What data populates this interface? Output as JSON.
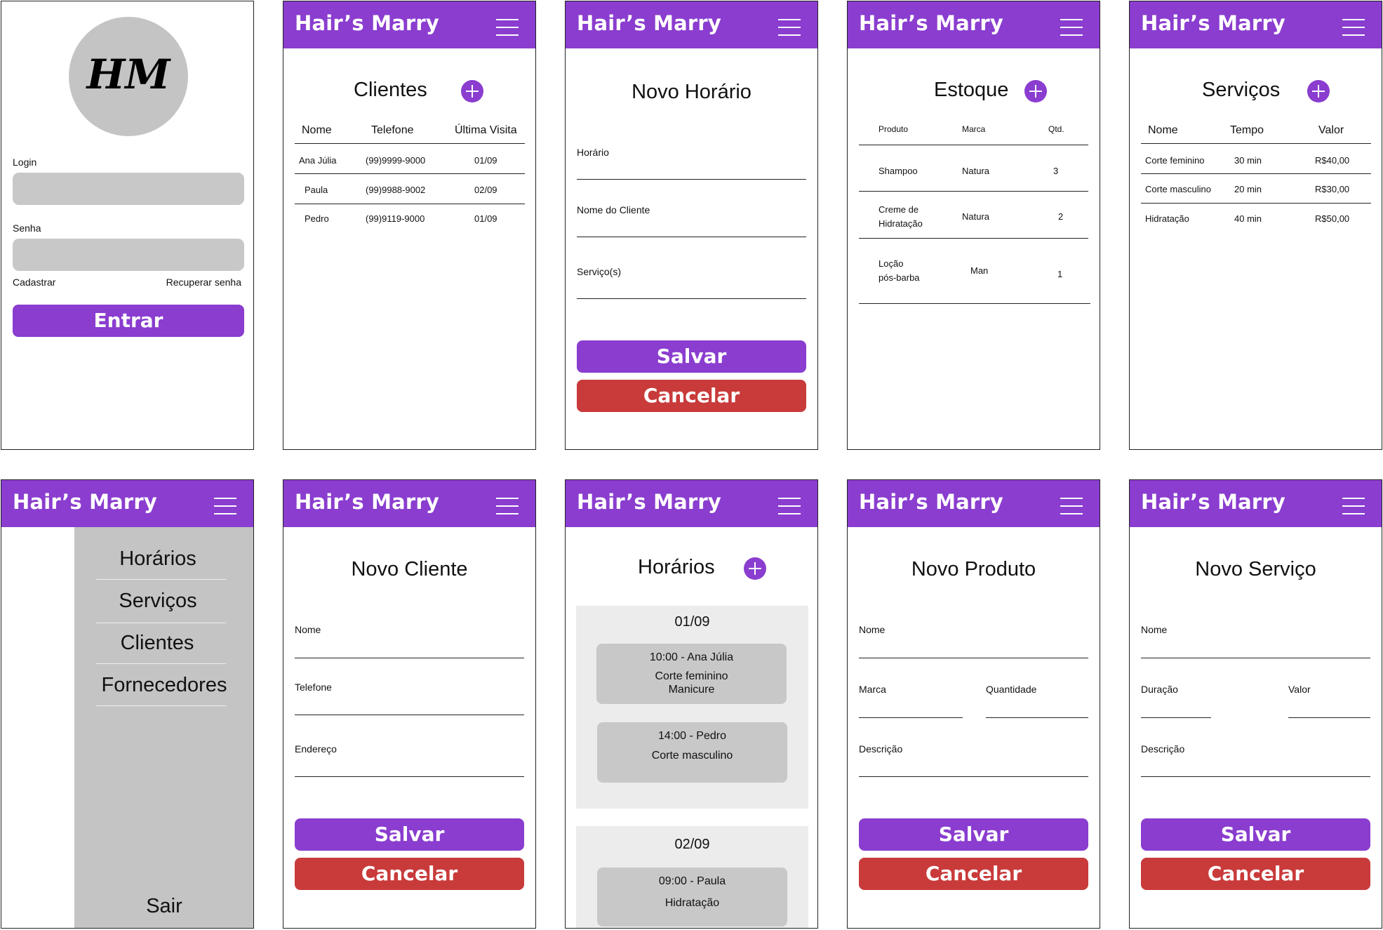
{
  "login": {
    "logo_text": "HM",
    "login_label": "Login",
    "password_label": "Senha",
    "register_link": "Cadastrar",
    "recover_link": "Recuperar senha",
    "enter_button": "Entrar"
  },
  "brand": "Hair’s Marry",
  "clientes": {
    "title": "Clientes",
    "columns": [
      "Nome",
      "Telefone",
      "Última Visita"
    ],
    "rows": [
      {
        "name": "Ana Júlia",
        "phone": "(99)9999-9000",
        "last": "01/09"
      },
      {
        "name": "Paula",
        "phone": "(99)9988-9002",
        "last": "02/09"
      },
      {
        "name": "Pedro",
        "phone": "(99)9119-9000",
        "last": "01/09"
      }
    ]
  },
  "novo_horario": {
    "title": "Novo Horário",
    "fields": [
      "Horário",
      "Nome do Cliente",
      "Serviço(s)"
    ],
    "save": "Salvar",
    "cancel": "Cancelar"
  },
  "estoque": {
    "title": "Estoque",
    "columns": [
      "Produto",
      "Marca",
      "Qtd."
    ],
    "rows": [
      {
        "product": "Shampoo",
        "brand": "Natura",
        "qty": "3"
      },
      {
        "product": "Creme de Hidratação",
        "product_line1": "Creme de",
        "product_line2": "Hidratação",
        "brand": "Natura",
        "qty": "2"
      },
      {
        "product": "Loção pós-barba",
        "product_line1": "Loção",
        "product_line2": "pós-barba",
        "brand": "Man",
        "qty": "1"
      }
    ]
  },
  "servicos": {
    "title": "Serviços",
    "columns": [
      "Nome",
      "Tempo",
      "Valor"
    ],
    "rows": [
      {
        "name": "Corte feminino",
        "time": "30 min",
        "value": "R$40,00"
      },
      {
        "name": "Corte masculino",
        "time": "20 min",
        "value": "R$30,00"
      },
      {
        "name": "Hidratação",
        "time": "40 min",
        "value": "R$50,00"
      }
    ]
  },
  "menu": {
    "items": [
      "Horários",
      "Serviços",
      "Clientes",
      "Fornecedores"
    ],
    "logout": "Sair"
  },
  "novo_cliente": {
    "title": "Novo Cliente",
    "fields": [
      "Nome",
      "Telefone",
      "Endereço"
    ],
    "save": "Salvar",
    "cancel": "Cancelar"
  },
  "horarios": {
    "title": "Horários",
    "days": [
      {
        "date": "01/09",
        "appointments": [
          {
            "line1": "10:00 - Ana Júlia",
            "line2": "Corte feminino",
            "line3": "Manicure"
          },
          {
            "line1": "14:00 - Pedro",
            "line2": "Corte masculino"
          }
        ]
      },
      {
        "date": "02/09",
        "appointments": [
          {
            "line1": "09:00 - Paula",
            "line2": "Hidratação"
          }
        ]
      }
    ]
  },
  "novo_produto": {
    "title": "Novo Produto",
    "fields": [
      "Nome",
      "Marca",
      "Quantidade",
      "Descrição"
    ],
    "save": "Salvar",
    "cancel": "Cancelar"
  },
  "novo_servico": {
    "title": "Novo Serviço",
    "fields": [
      "Nome",
      "Duração",
      "Valor",
      "Descrição"
    ],
    "save": "Salvar",
    "cancel": "Cancelar"
  },
  "colors": {
    "primary": "#8a3dcf",
    "danger": "#c93a3a",
    "input_gray": "#c8c8c8",
    "menu_gray": "#c4c4c4",
    "day_panel": "#ececec"
  }
}
